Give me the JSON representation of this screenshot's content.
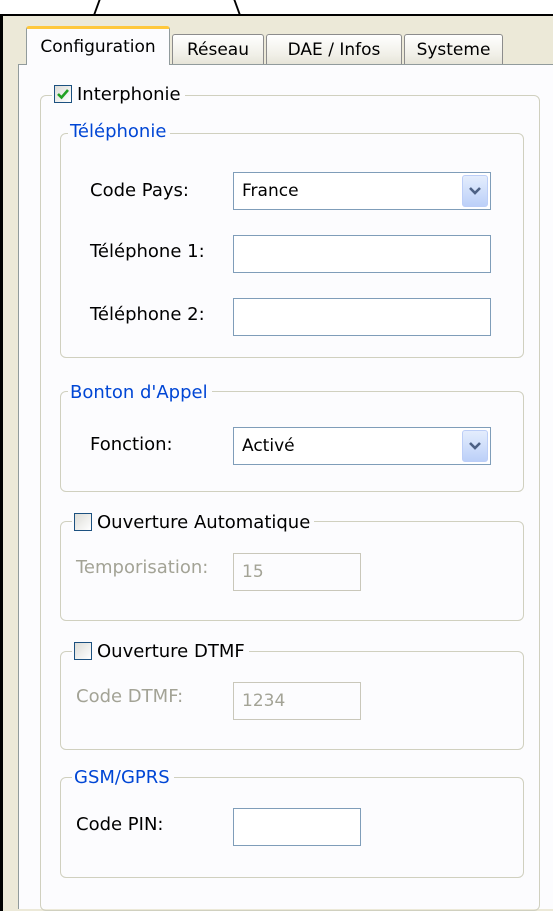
{
  "tabs": [
    {
      "label": "Configuration",
      "active": true
    },
    {
      "label": "Réseau",
      "active": false
    },
    {
      "label": "DAE / Infos",
      "active": false
    },
    {
      "label": "Systeme",
      "active": false
    }
  ],
  "interphonie": {
    "label": "Interphonie",
    "checked": true
  },
  "telephonie": {
    "title": "Téléphonie",
    "code_pays_label": "Code Pays:",
    "code_pays_value": "France",
    "tel1_label": "Téléphone 1:",
    "tel1_value": "",
    "tel2_label": "Téléphone 2:",
    "tel2_value": ""
  },
  "bouton_appel": {
    "title": "Bonton d'Appel",
    "fonction_label": "Fonction:",
    "fonction_value": "Activé"
  },
  "ouverture_auto": {
    "label": "Ouverture Automatique",
    "checked": false,
    "tempo_label": "Temporisation:",
    "tempo_value": "15"
  },
  "ouverture_dtmf": {
    "label": "Ouverture DTMF",
    "checked": false,
    "code_label": "Code DTMF:",
    "code_value": "1234"
  },
  "gsm": {
    "title": "GSM/GPRS",
    "pin_label": "Code PIN:",
    "pin_value": ""
  },
  "colors": {
    "group_title": "#0046d5",
    "tab_highlight": "#ffc83c",
    "disabled_text": "#a3a396"
  }
}
